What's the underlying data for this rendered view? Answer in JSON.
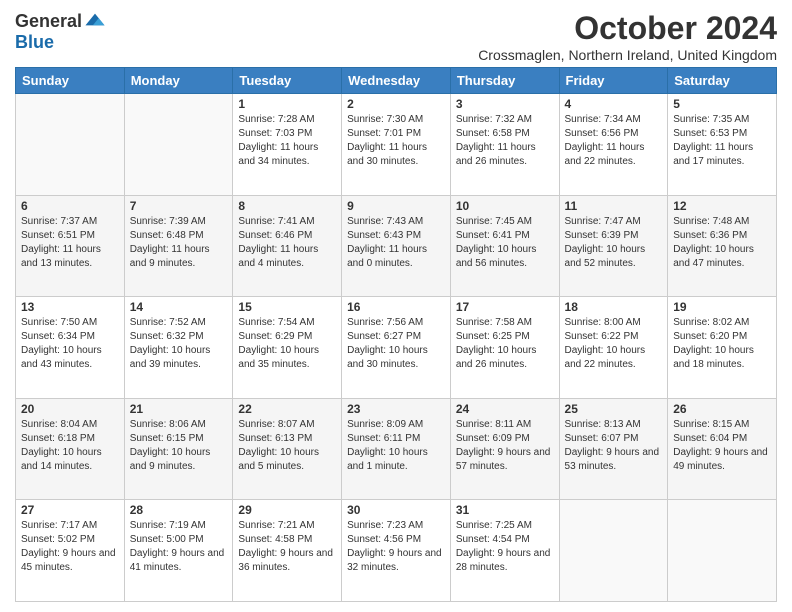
{
  "logo": {
    "general": "General",
    "blue": "Blue"
  },
  "title": "October 2024",
  "location": "Crossmaglen, Northern Ireland, United Kingdom",
  "days_header": [
    "Sunday",
    "Monday",
    "Tuesday",
    "Wednesday",
    "Thursday",
    "Friday",
    "Saturday"
  ],
  "weeks": [
    [
      {
        "day": "",
        "sunrise": "",
        "sunset": "",
        "daylight": ""
      },
      {
        "day": "",
        "sunrise": "",
        "sunset": "",
        "daylight": ""
      },
      {
        "day": "1",
        "sunrise": "Sunrise: 7:28 AM",
        "sunset": "Sunset: 7:03 PM",
        "daylight": "Daylight: 11 hours and 34 minutes."
      },
      {
        "day": "2",
        "sunrise": "Sunrise: 7:30 AM",
        "sunset": "Sunset: 7:01 PM",
        "daylight": "Daylight: 11 hours and 30 minutes."
      },
      {
        "day": "3",
        "sunrise": "Sunrise: 7:32 AM",
        "sunset": "Sunset: 6:58 PM",
        "daylight": "Daylight: 11 hours and 26 minutes."
      },
      {
        "day": "4",
        "sunrise": "Sunrise: 7:34 AM",
        "sunset": "Sunset: 6:56 PM",
        "daylight": "Daylight: 11 hours and 22 minutes."
      },
      {
        "day": "5",
        "sunrise": "Sunrise: 7:35 AM",
        "sunset": "Sunset: 6:53 PM",
        "daylight": "Daylight: 11 hours and 17 minutes."
      }
    ],
    [
      {
        "day": "6",
        "sunrise": "Sunrise: 7:37 AM",
        "sunset": "Sunset: 6:51 PM",
        "daylight": "Daylight: 11 hours and 13 minutes."
      },
      {
        "day": "7",
        "sunrise": "Sunrise: 7:39 AM",
        "sunset": "Sunset: 6:48 PM",
        "daylight": "Daylight: 11 hours and 9 minutes."
      },
      {
        "day": "8",
        "sunrise": "Sunrise: 7:41 AM",
        "sunset": "Sunset: 6:46 PM",
        "daylight": "Daylight: 11 hours and 4 minutes."
      },
      {
        "day": "9",
        "sunrise": "Sunrise: 7:43 AM",
        "sunset": "Sunset: 6:43 PM",
        "daylight": "Daylight: 11 hours and 0 minutes."
      },
      {
        "day": "10",
        "sunrise": "Sunrise: 7:45 AM",
        "sunset": "Sunset: 6:41 PM",
        "daylight": "Daylight: 10 hours and 56 minutes."
      },
      {
        "day": "11",
        "sunrise": "Sunrise: 7:47 AM",
        "sunset": "Sunset: 6:39 PM",
        "daylight": "Daylight: 10 hours and 52 minutes."
      },
      {
        "day": "12",
        "sunrise": "Sunrise: 7:48 AM",
        "sunset": "Sunset: 6:36 PM",
        "daylight": "Daylight: 10 hours and 47 minutes."
      }
    ],
    [
      {
        "day": "13",
        "sunrise": "Sunrise: 7:50 AM",
        "sunset": "Sunset: 6:34 PM",
        "daylight": "Daylight: 10 hours and 43 minutes."
      },
      {
        "day": "14",
        "sunrise": "Sunrise: 7:52 AM",
        "sunset": "Sunset: 6:32 PM",
        "daylight": "Daylight: 10 hours and 39 minutes."
      },
      {
        "day": "15",
        "sunrise": "Sunrise: 7:54 AM",
        "sunset": "Sunset: 6:29 PM",
        "daylight": "Daylight: 10 hours and 35 minutes."
      },
      {
        "day": "16",
        "sunrise": "Sunrise: 7:56 AM",
        "sunset": "Sunset: 6:27 PM",
        "daylight": "Daylight: 10 hours and 30 minutes."
      },
      {
        "day": "17",
        "sunrise": "Sunrise: 7:58 AM",
        "sunset": "Sunset: 6:25 PM",
        "daylight": "Daylight: 10 hours and 26 minutes."
      },
      {
        "day": "18",
        "sunrise": "Sunrise: 8:00 AM",
        "sunset": "Sunset: 6:22 PM",
        "daylight": "Daylight: 10 hours and 22 minutes."
      },
      {
        "day": "19",
        "sunrise": "Sunrise: 8:02 AM",
        "sunset": "Sunset: 6:20 PM",
        "daylight": "Daylight: 10 hours and 18 minutes."
      }
    ],
    [
      {
        "day": "20",
        "sunrise": "Sunrise: 8:04 AM",
        "sunset": "Sunset: 6:18 PM",
        "daylight": "Daylight: 10 hours and 14 minutes."
      },
      {
        "day": "21",
        "sunrise": "Sunrise: 8:06 AM",
        "sunset": "Sunset: 6:15 PM",
        "daylight": "Daylight: 10 hours and 9 minutes."
      },
      {
        "day": "22",
        "sunrise": "Sunrise: 8:07 AM",
        "sunset": "Sunset: 6:13 PM",
        "daylight": "Daylight: 10 hours and 5 minutes."
      },
      {
        "day": "23",
        "sunrise": "Sunrise: 8:09 AM",
        "sunset": "Sunset: 6:11 PM",
        "daylight": "Daylight: 10 hours and 1 minute."
      },
      {
        "day": "24",
        "sunrise": "Sunrise: 8:11 AM",
        "sunset": "Sunset: 6:09 PM",
        "daylight": "Daylight: 9 hours and 57 minutes."
      },
      {
        "day": "25",
        "sunrise": "Sunrise: 8:13 AM",
        "sunset": "Sunset: 6:07 PM",
        "daylight": "Daylight: 9 hours and 53 minutes."
      },
      {
        "day": "26",
        "sunrise": "Sunrise: 8:15 AM",
        "sunset": "Sunset: 6:04 PM",
        "daylight": "Daylight: 9 hours and 49 minutes."
      }
    ],
    [
      {
        "day": "27",
        "sunrise": "Sunrise: 7:17 AM",
        "sunset": "Sunset: 5:02 PM",
        "daylight": "Daylight: 9 hours and 45 minutes."
      },
      {
        "day": "28",
        "sunrise": "Sunrise: 7:19 AM",
        "sunset": "Sunset: 5:00 PM",
        "daylight": "Daylight: 9 hours and 41 minutes."
      },
      {
        "day": "29",
        "sunrise": "Sunrise: 7:21 AM",
        "sunset": "Sunset: 4:58 PM",
        "daylight": "Daylight: 9 hours and 36 minutes."
      },
      {
        "day": "30",
        "sunrise": "Sunrise: 7:23 AM",
        "sunset": "Sunset: 4:56 PM",
        "daylight": "Daylight: 9 hours and 32 minutes."
      },
      {
        "day": "31",
        "sunrise": "Sunrise: 7:25 AM",
        "sunset": "Sunset: 4:54 PM",
        "daylight": "Daylight: 9 hours and 28 minutes."
      },
      {
        "day": "",
        "sunrise": "",
        "sunset": "",
        "daylight": ""
      },
      {
        "day": "",
        "sunrise": "",
        "sunset": "",
        "daylight": ""
      }
    ]
  ]
}
